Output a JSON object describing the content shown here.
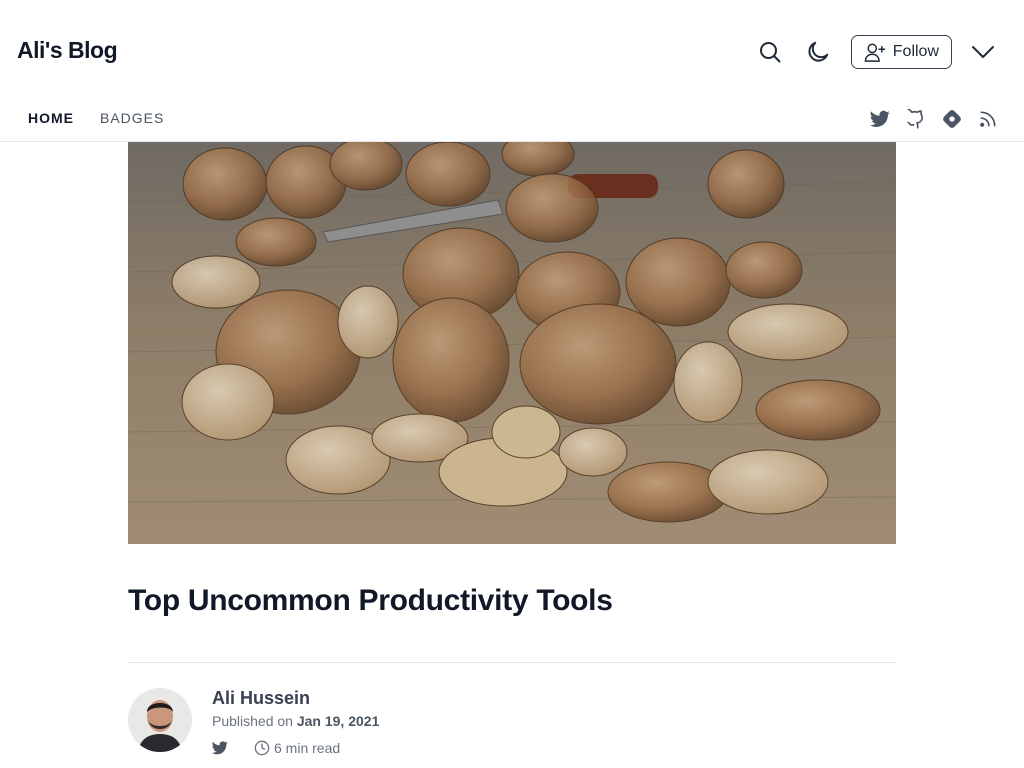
{
  "header": {
    "blog_title": "Ali's Blog",
    "follow_label": "Follow"
  },
  "nav": {
    "tabs": [
      {
        "label": "HOME",
        "active": true
      },
      {
        "label": "BADGES",
        "active": false
      }
    ],
    "socials": [
      "twitter-icon",
      "github-icon",
      "hashnode-icon",
      "rss-icon"
    ]
  },
  "cover": {
    "subject": "walnuts"
  },
  "post": {
    "title": "Top Uncommon Productivity Tools"
  },
  "author": {
    "name": "Ali Hussein",
    "published_prefix": "Published on",
    "date": "Jan 19, 2021",
    "read_time": "6 min read"
  },
  "colors": {
    "text": "#111827",
    "muted": "#6b7280",
    "border": "#e5e7eb"
  }
}
